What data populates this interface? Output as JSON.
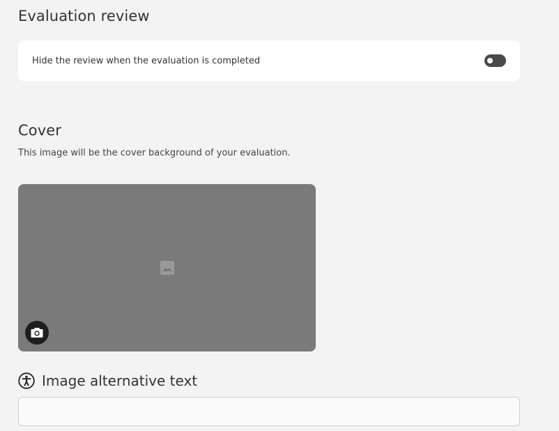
{
  "evaluation_review": {
    "title": "Evaluation review",
    "hide_review_label": "Hide the review when the evaluation is completed",
    "hide_review_enabled": false
  },
  "cover": {
    "title": "Cover",
    "description": "This image will be the cover background of your evaluation.",
    "placeholder_icon": "image-icon",
    "upload_icon": "camera-icon"
  },
  "alt_text": {
    "icon": "accessibility-icon",
    "label": "Image alternative text",
    "value": "",
    "placeholder": ""
  },
  "colors": {
    "background": "#f3f3f3",
    "card": "#ffffff",
    "cover_placeholder": "#7a7a7a",
    "toggle_off": "#4a4a4a",
    "camera_button": "#1e1e1e"
  }
}
